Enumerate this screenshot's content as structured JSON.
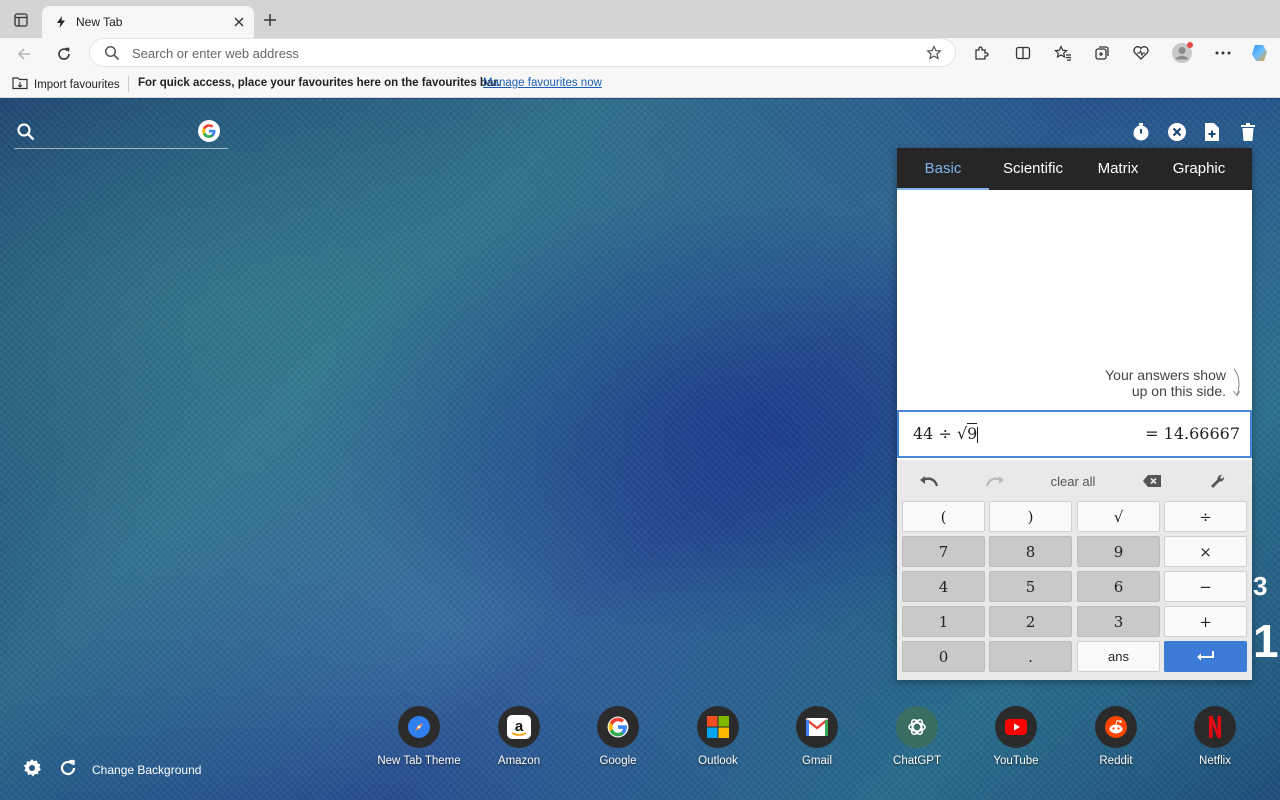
{
  "browser": {
    "tab_title": "New Tab",
    "address_placeholder": "Search or enter web address",
    "favbar": {
      "import_label": "Import favourites",
      "message": "For quick access, place your favourites here on the favourites bar.",
      "manage_link": "Manage favourites now"
    }
  },
  "newtab": {
    "search_placeholder": "",
    "change_background_label": "Change Background"
  },
  "calculator": {
    "tabs": [
      "Basic",
      "Scientific",
      "Matrix",
      "Graphic"
    ],
    "active_tab": "Basic",
    "hint_line1": "Your answers show",
    "hint_line2": "up on this side.",
    "expression_prefix": "44 ÷ ",
    "expression_radical": "√",
    "expression_radicand": "9",
    "result": "= 14.66667",
    "clear_all_label": "clear all",
    "keys": [
      [
        "(",
        ")",
        "√",
        "÷"
      ],
      [
        "7",
        "8",
        "9",
        "×"
      ],
      [
        "4",
        "5",
        "6",
        "−"
      ],
      [
        "1",
        "2",
        "3",
        "+"
      ],
      [
        "0",
        ".",
        "ans",
        "↵"
      ]
    ]
  },
  "side_glyphs": [
    "3",
    "1"
  ],
  "shortcuts": [
    {
      "label": "New Tab Theme",
      "icon": "compass-icon"
    },
    {
      "label": "Amazon",
      "icon": "amazon-icon"
    },
    {
      "label": "Google",
      "icon": "google-icon"
    },
    {
      "label": "Outlook",
      "icon": "microsoft-icon"
    },
    {
      "label": "Gmail",
      "icon": "gmail-icon"
    },
    {
      "label": "ChatGPT",
      "icon": "chatgpt-icon"
    },
    {
      "label": "YouTube",
      "icon": "youtube-icon"
    },
    {
      "label": "Reddit",
      "icon": "reddit-icon"
    },
    {
      "label": "Netflix",
      "icon": "netflix-icon"
    }
  ],
  "colors": {
    "calc_accent": "#3c7bd8",
    "calc_tab_bar": "#262626",
    "link": "#1a5fb4"
  }
}
